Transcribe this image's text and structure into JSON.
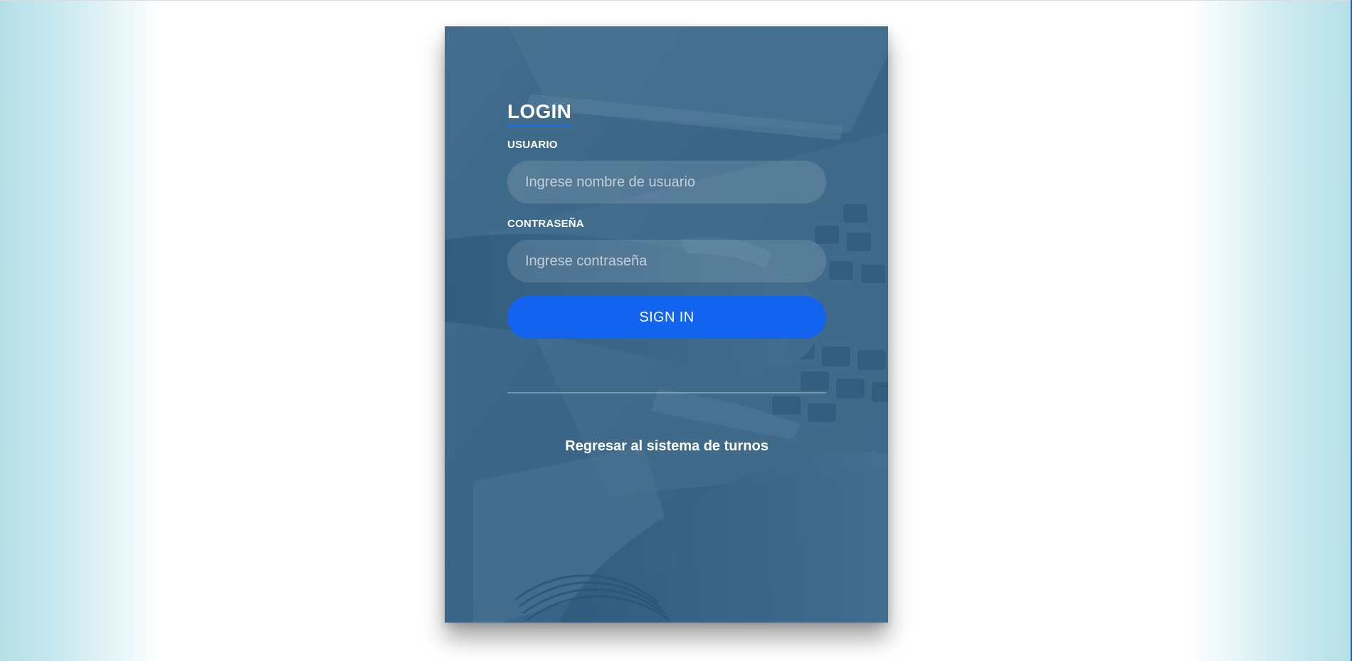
{
  "login": {
    "title": "LOGIN",
    "username": {
      "label": "USUARIO",
      "placeholder": "Ingrese nombre de usuario",
      "value": ""
    },
    "password": {
      "label": "CONTRASEÑA",
      "placeholder": "Ingrese contraseña",
      "value": ""
    },
    "submit_label": "SIGN IN",
    "back_link_label": "Regresar al sistema de turnos"
  },
  "colors": {
    "accent": "#1264ef",
    "card_tint": "#4b7592",
    "page_edge": "#b5e0e8"
  }
}
